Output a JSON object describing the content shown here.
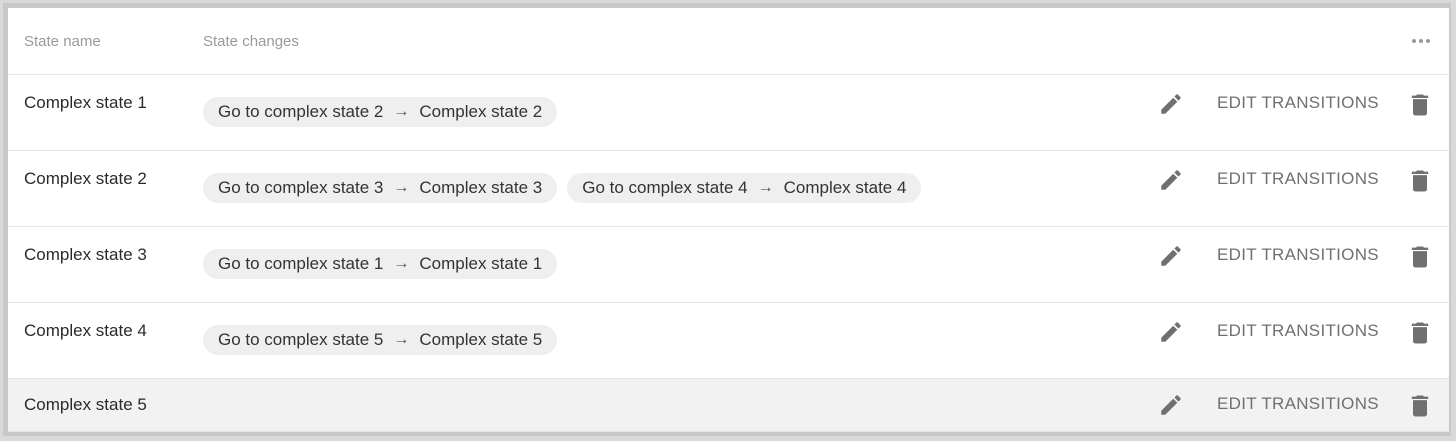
{
  "header": {
    "state_name_label": "State name",
    "state_changes_label": "State changes",
    "more_icon": "more-horizontal-icon"
  },
  "actions": {
    "edit_transitions_label": "EDIT TRANSITIONS",
    "edit_icon": "pencil-icon",
    "delete_icon": "trash-icon"
  },
  "colors": {
    "chip_bg": "#efefef",
    "icon": "#707070",
    "header_text": "#9a9a9a",
    "selected_row_bg": "#f2f2f2"
  },
  "rows": [
    {
      "name": "Complex state 1",
      "changes": [
        {
          "action": "Go to complex state 2",
          "arrow": "→",
          "target": "Complex state 2"
        }
      ]
    },
    {
      "name": "Complex state 2",
      "changes": [
        {
          "action": "Go to complex state 3",
          "arrow": "→",
          "target": "Complex state 3"
        },
        {
          "action": "Go to complex state 4",
          "arrow": "→",
          "target": "Complex state 4"
        }
      ]
    },
    {
      "name": "Complex state 3",
      "changes": [
        {
          "action": "Go to complex state 1",
          "arrow": "→",
          "target": "Complex state 1"
        }
      ]
    },
    {
      "name": "Complex state 4",
      "changes": [
        {
          "action": "Go to complex state 5",
          "arrow": "→",
          "target": "Complex state 5"
        }
      ]
    },
    {
      "name": "Complex state 5",
      "changes": []
    }
  ]
}
